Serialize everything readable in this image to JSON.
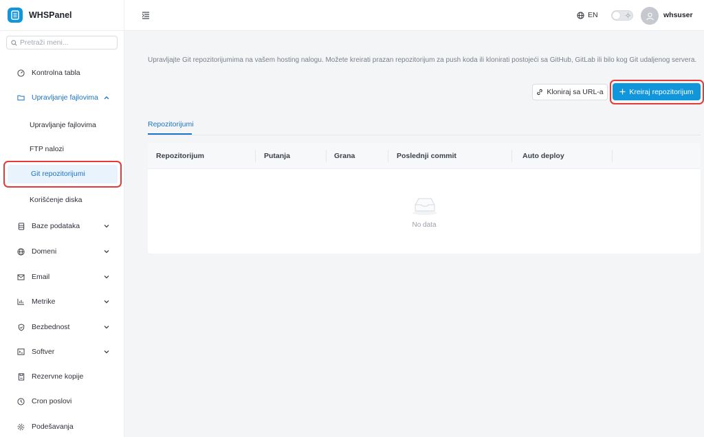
{
  "app": {
    "name": "WHSPanel"
  },
  "sidebar": {
    "search_placeholder": "Pretraži meni...",
    "items": [
      {
        "label": "Kontrolna tabla"
      },
      {
        "label": "Upravljanje fajlovima"
      },
      {
        "label": "Baze podataka"
      },
      {
        "label": "Domeni"
      },
      {
        "label": "Email"
      },
      {
        "label": "Metrike"
      },
      {
        "label": "Bezbednost"
      },
      {
        "label": "Softver"
      },
      {
        "label": "Rezervne kopije"
      },
      {
        "label": "Cron poslovi"
      },
      {
        "label": "Podešavanja"
      }
    ],
    "subitems": [
      {
        "label": "Upravljanje fajlovima"
      },
      {
        "label": "FTP nalozi"
      },
      {
        "label": "Git repozitorijumi"
      },
      {
        "label": "Korišćenje diska"
      }
    ]
  },
  "header": {
    "language": "EN",
    "username": "whsuser"
  },
  "main": {
    "description": "Upravljajte Git repozitorijumima na vašem hosting nalogu. Možete kreirati prazan repozitorijum za push koda ili klonirati postojeći sa GitHub, GitLab ili bilo kog Git udaljenog servera.",
    "clone_button": "Kloniraj sa URL-a",
    "create_button": "Kreiraj repozitorijum",
    "tab": "Repozitorijumi",
    "columns": [
      "Repozitorijum",
      "Putanja",
      "Grana",
      "Poslednji commit",
      "Auto deploy"
    ],
    "empty_text": "No data"
  },
  "colors": {
    "accent": "#1296db",
    "highlight": "#e53935"
  }
}
